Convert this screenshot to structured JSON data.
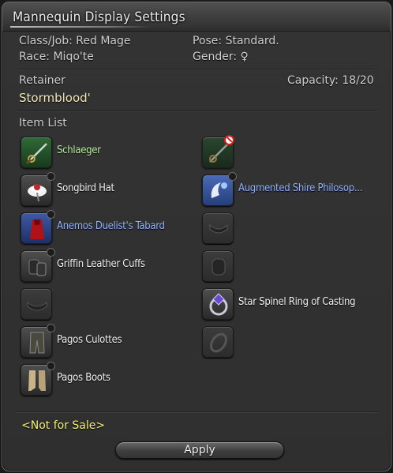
{
  "window": {
    "title": "Mannequin Display Settings"
  },
  "info": {
    "class_job": "Class/Job: Red Mage",
    "pose": "Pose: Standard.",
    "race": "Race: Miqo'te",
    "gender": "Gender: ♀"
  },
  "retainer": {
    "label": "Retainer",
    "capacity": "Capacity: 18/20",
    "name": "Stormblood'"
  },
  "item_list": {
    "label": "Item List",
    "left": [
      {
        "name": "Schlaeger",
        "icon": "rapier-icon"
      },
      {
        "name": "Songbird Hat",
        "icon": "hat-icon"
      },
      {
        "name": "Anemos Duelist's Tabard",
        "icon": "tabard-icon"
      },
      {
        "name": "Griffin Leather Cuffs",
        "icon": "gloves-icon"
      },
      {
        "name": "",
        "icon": "belt-slot-icon"
      },
      {
        "name": "Pagos Culottes",
        "icon": "legs-icon"
      },
      {
        "name": "Pagos Boots",
        "icon": "boots-icon"
      }
    ],
    "right": [
      {
        "name": "",
        "icon": "rapier-icon",
        "status": "prohibited-icon"
      },
      {
        "name": "Augmented Shire Philosop...",
        "icon": "focus-icon"
      },
      {
        "name": "",
        "icon": "necklace-slot-icon"
      },
      {
        "name": "",
        "icon": "bracelet-slot-icon"
      },
      {
        "name": "Star Spinel Ring of Casting",
        "icon": "ring-icon"
      },
      {
        "name": "",
        "icon": "ring-slot-icon"
      }
    ]
  },
  "footer": {
    "status": "<Not for Sale>",
    "apply_label": "Apply"
  },
  "colors": {
    "title_text": "#ececec",
    "retainer_name": "#f2e6b8",
    "rare_item": "#b7f0a0",
    "aetherial_item": "#8fb3ff",
    "not_for_sale": "#f5f078"
  }
}
